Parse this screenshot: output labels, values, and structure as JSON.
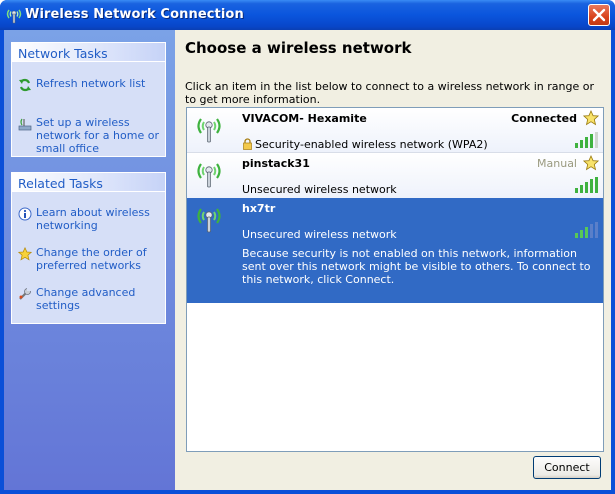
{
  "window": {
    "title": "Wireless Network Connection",
    "icons": {
      "title": "wireless-antenna-icon",
      "close": "close-icon"
    },
    "colors": {
      "titlebar": "#0a55dd",
      "close": "#d9431c",
      "selection": "#316ac5",
      "link": "#215dc6"
    }
  },
  "sidebar": {
    "network_tasks": {
      "header": "Network Tasks",
      "items": [
        {
          "label": "Refresh network list",
          "icon": "refresh-icon"
        },
        {
          "label": "Set up a wireless network for a home or small office",
          "icon": "setup-wizard-icon"
        }
      ]
    },
    "related_tasks": {
      "header": "Related Tasks",
      "items": [
        {
          "label": "Learn about wireless networking",
          "icon": "info-icon"
        },
        {
          "label": "Change the order of preferred networks",
          "icon": "star-icon"
        },
        {
          "label": "Change advanced settings",
          "icon": "settings-icon"
        }
      ]
    }
  },
  "main": {
    "heading": "Choose a wireless network",
    "instructions": "Click an item in the list below to connect to a wireless network in range or to get more information.",
    "networks": [
      {
        "name": "VIVACOM- Hexamite",
        "status": "Connected",
        "description": "Security-enabled wireless network (WPA2)",
        "secured": true,
        "signal_bars": 4,
        "preferred": true,
        "selected": false
      },
      {
        "name": "pinstack31",
        "status": "Manual",
        "description": "Unsecured wireless network",
        "secured": false,
        "signal_bars": 5,
        "preferred": true,
        "selected": false
      },
      {
        "name": "hx7tr",
        "status": "",
        "description": "Unsecured wireless network",
        "secured": false,
        "signal_bars": 3,
        "preferred": false,
        "selected": true,
        "note": "Because security is not enabled on this network, information sent over this network might be visible to others. To connect to this network, click Connect."
      }
    ],
    "connect_label": "Connect"
  }
}
